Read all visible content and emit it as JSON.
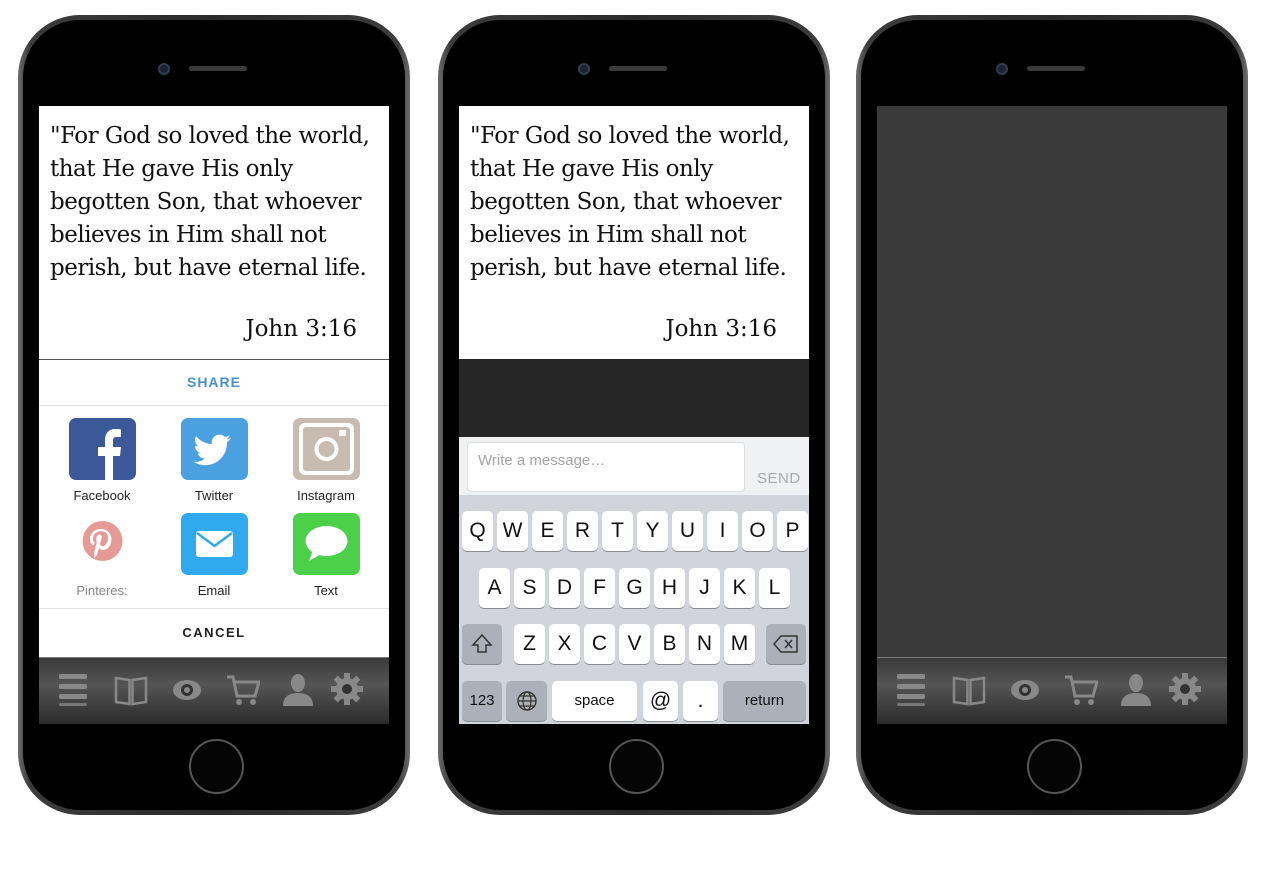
{
  "verse": {
    "text": "\"For God so loved the world,\nthat He gave His only\nbegotten Son, that whoever\nbelieves in Him shall not\nperish, but have eternal life.",
    "reference": "John 3:16"
  },
  "share_sheet": {
    "title": "SHARE",
    "items": [
      {
        "label": "Facebook",
        "icon": "facebook-icon",
        "color": "#3b5998"
      },
      {
        "label": "Twitter",
        "icon": "twitter-icon",
        "color": "#4ba0e0"
      },
      {
        "label": "Instagram",
        "icon": "instagram-icon",
        "color": "#c8bcb1"
      },
      {
        "label": "Pinteres:",
        "icon": "pinterest-icon",
        "color": "#e69a95"
      },
      {
        "label": "Email",
        "icon": "email-icon",
        "color": "#2fa9f0"
      },
      {
        "label": "Text",
        "icon": "text-message-icon",
        "color": "#4cd04a"
      }
    ],
    "cancel_label": "CANCEL"
  },
  "tabbar": {
    "icons": [
      "menu-icon",
      "book-icon",
      "eye-icon",
      "cart-icon",
      "profile-icon",
      "settings-gear-icon"
    ]
  },
  "chat": {
    "placeholder": "Write a message…",
    "send_label": "SEND"
  },
  "keyboard": {
    "row1": [
      "Q",
      "W",
      "E",
      "R",
      "T",
      "Y",
      "U",
      "I",
      "O",
      "P"
    ],
    "row2": [
      "A",
      "S",
      "D",
      "F",
      "G",
      "H",
      "J",
      "K",
      "L"
    ],
    "row3": [
      "Z",
      "X",
      "C",
      "V",
      "B",
      "N",
      "M"
    ],
    "numbers_key": "123",
    "space_key": "space",
    "at_key": "@",
    "dot_key": ".",
    "return_key": "return"
  }
}
